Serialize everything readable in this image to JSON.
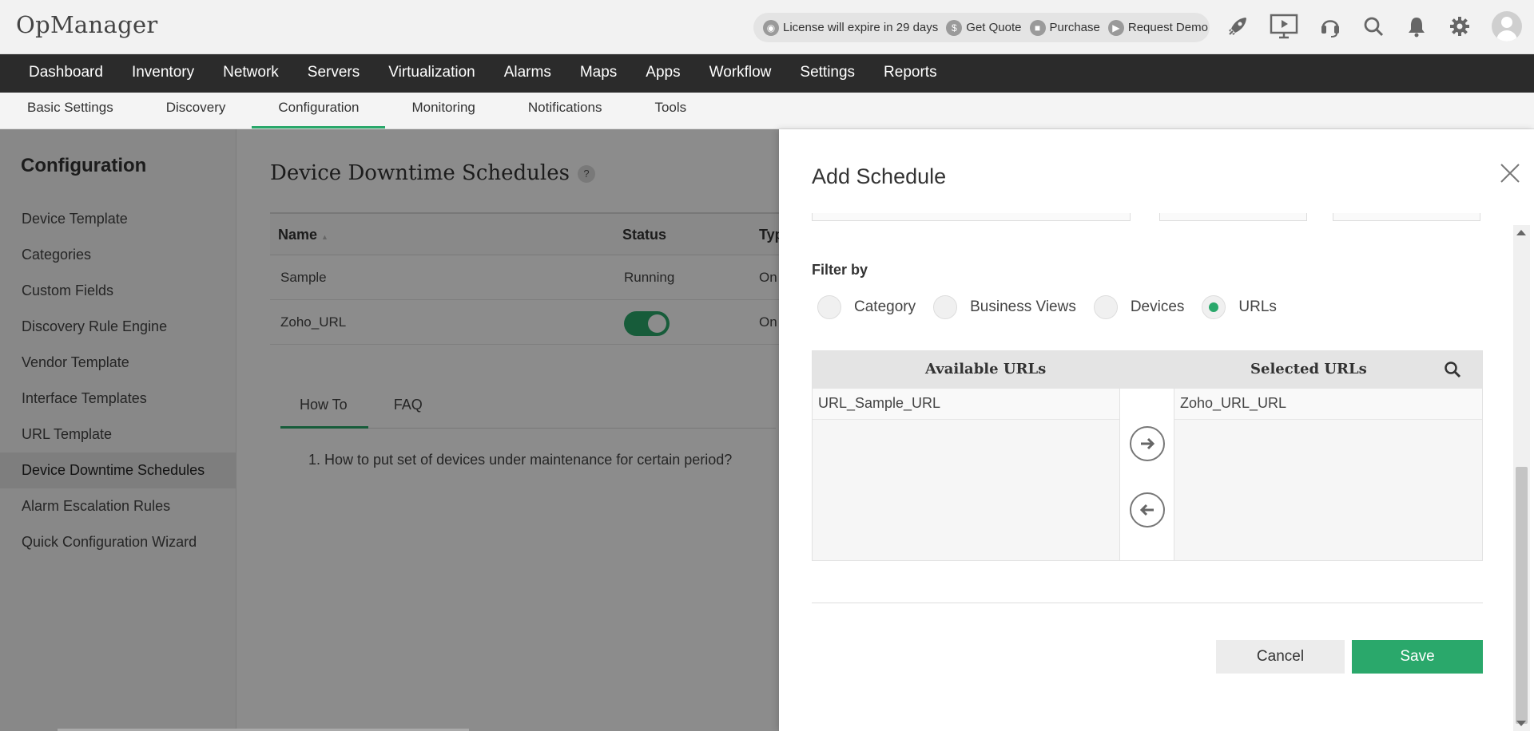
{
  "app": {
    "name": "OpManager"
  },
  "license_bar": {
    "license_text": "License will expire in 29 days",
    "get_quote": "Get Quote",
    "purchase": "Purchase",
    "request_demo": "Request Demo"
  },
  "header_icons": [
    "rocket-icon",
    "presentation-icon",
    "headset-icon",
    "search-icon",
    "bell-icon",
    "gear-icon",
    "avatar"
  ],
  "main_nav": [
    "Dashboard",
    "Inventory",
    "Network",
    "Servers",
    "Virtualization",
    "Alarms",
    "Maps",
    "Apps",
    "Workflow",
    "Settings",
    "Reports"
  ],
  "sub_nav": {
    "items": [
      "Basic Settings",
      "Discovery",
      "Configuration",
      "Monitoring",
      "Notifications",
      "Tools"
    ],
    "active": "Configuration"
  },
  "sidebar": {
    "title": "Configuration",
    "items": [
      "Device Template",
      "Categories",
      "Custom Fields",
      "Discovery Rule Engine",
      "Vendor Template",
      "Interface Templates",
      "URL Template",
      "Device Downtime Schedules",
      "Alarm Escalation Rules",
      "Quick Configuration Wizard"
    ],
    "active": "Device Downtime Schedules"
  },
  "content": {
    "title": "Device Downtime Schedules",
    "help_badge": "?",
    "table": {
      "headers": {
        "name": "Name",
        "name_sort_glyph": "▲",
        "status": "Status",
        "type": "Typ"
      },
      "rows": [
        {
          "name": "Sample",
          "status": "Running",
          "type": "On"
        },
        {
          "name": "Zoho_URL",
          "status_toggle": "on",
          "type": "On"
        }
      ]
    },
    "tabs": [
      "How To",
      "FAQ"
    ],
    "active_tab": "How To",
    "howto_text": "1. How to put set of devices under maintenance for certain period?"
  },
  "dialog": {
    "title": "Add Schedule",
    "filter_label": "Filter by",
    "filter_options": [
      "Category",
      "Business Views",
      "Devices",
      "URLs"
    ],
    "filter_selected": "URLs",
    "available_header": "Available URLs",
    "selected_header": "Selected URLs",
    "available_items": [
      "URL_Sample_URL"
    ],
    "selected_items": [
      "Zoho_URL_URL"
    ],
    "cancel_label": "Cancel",
    "save_label": "Save"
  },
  "colors": {
    "accent": "#2aa86b",
    "nav_bg": "#2b2b2b",
    "header_bg": "#f2f2f2"
  }
}
